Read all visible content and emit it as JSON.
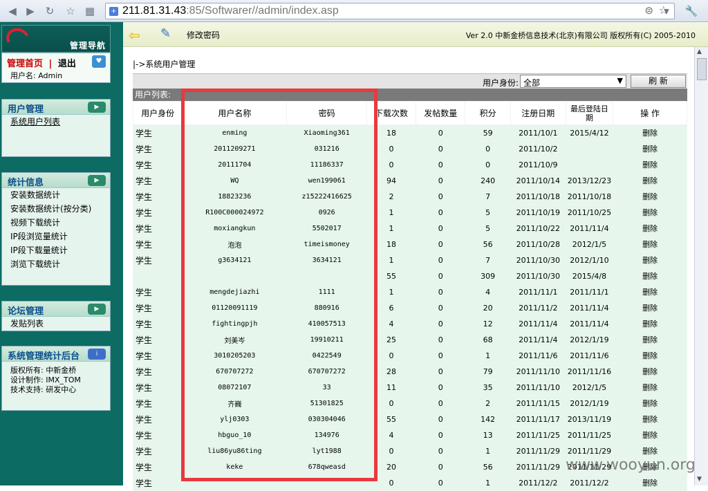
{
  "browser": {
    "url_host": "211.81.31.43",
    "url_rest": ":85/Softwarer//admin/index.asp"
  },
  "sidebar": {
    "nav_title": "管理导航",
    "home_link": "管理首页",
    "separator": "|",
    "logout_link": "退出",
    "username_line": "用户名: Admin",
    "user_mgmt": {
      "title": "用户管理",
      "items": [
        "系统用户列表"
      ]
    },
    "stats": {
      "title": "统计信息",
      "items": [
        "安装数据统计",
        "安装数据统计(按分类)",
        "视频下载统计",
        "IP段浏览量统计",
        "IP段下载量统计",
        "浏览下载统计"
      ]
    },
    "forum": {
      "title": "论坛管理",
      "items": [
        "发贴列表"
      ]
    },
    "backend": {
      "title": "系统管理统计后台",
      "lines": [
        "版权所有: 中新金桥",
        "设计制作: IMX_TOM",
        "技术支持: 研发中心"
      ]
    }
  },
  "topbar": {
    "change_password": "修改密码",
    "copyright": "Ver 2.0 中新金桥信息技术(北京)有限公司 版权所有(C) 2005-2010"
  },
  "main": {
    "breadcrumb": "|->系统用户管理",
    "filter_label": "用户身份:",
    "filter_value": "全部",
    "refresh_label": "刷 新",
    "list_label": "用户列表:",
    "columns": [
      "用户身份",
      "用户名称",
      "密码",
      "下载次数",
      "发帖数量",
      "积分",
      "注册日期",
      "最后登陆日期",
      "操 作"
    ],
    "rows": [
      [
        "学生",
        "enming",
        "Xiaoming361",
        "18",
        "0",
        "59",
        "2011/10/1",
        "2015/4/12",
        "删除"
      ],
      [
        "学生",
        "2011209271",
        "031216",
        "0",
        "0",
        "0",
        "2011/10/2",
        "",
        "删除"
      ],
      [
        "学生",
        "20111704",
        "11186337",
        "0",
        "0",
        "0",
        "2011/10/9",
        "",
        "删除"
      ],
      [
        "学生",
        "WQ",
        "wen199061",
        "94",
        "0",
        "240",
        "2011/10/14",
        "2013/12/23",
        "删除"
      ],
      [
        "学生",
        "18823236",
        "z15222416625",
        "2",
        "0",
        "7",
        "2011/10/18",
        "2011/10/18",
        "删除"
      ],
      [
        "学生",
        "R100C000024972",
        "0926",
        "1",
        "0",
        "5",
        "2011/10/19",
        "2011/10/25",
        "删除"
      ],
      [
        "学生",
        "moxiangkun",
        "5502017",
        "1",
        "0",
        "5",
        "2011/10/22",
        "2011/11/4",
        "删除"
      ],
      [
        "学生",
        "泡泡",
        "timeismoney",
        "18",
        "0",
        "56",
        "2011/10/28",
        "2012/1/5",
        "删除"
      ],
      [
        "学生",
        "g3634121",
        "3634121",
        "1",
        "0",
        "7",
        "2011/10/30",
        "2012/1/10",
        "删除"
      ],
      [
        "",
        "",
        "",
        "55",
        "0",
        "309",
        "2011/10/30",
        "2015/4/8",
        "删除"
      ],
      [
        "学生",
        "mengdejiazhi",
        "1111",
        "1",
        "0",
        "4",
        "2011/11/1",
        "2011/11/1",
        "删除"
      ],
      [
        "学生",
        "01120091119",
        "880916",
        "6",
        "0",
        "20",
        "2011/11/2",
        "2011/11/4",
        "删除"
      ],
      [
        "学生",
        "fightingpjh",
        "410057513",
        "4",
        "0",
        "12",
        "2011/11/4",
        "2011/11/4",
        "删除"
      ],
      [
        "学生",
        "刘美岑",
        "19910211",
        "25",
        "0",
        "68",
        "2011/11/4",
        "2012/1/19",
        "删除"
      ],
      [
        "学生",
        "3010205203",
        "0422549",
        "0",
        "0",
        "1",
        "2011/11/6",
        "2011/11/6",
        "删除"
      ],
      [
        "学生",
        "670707272",
        "670707272",
        "28",
        "0",
        "79",
        "2011/11/10",
        "2011/11/16",
        "删除"
      ],
      [
        "学生",
        "08072107",
        "33",
        "11",
        "0",
        "35",
        "2011/11/10",
        "2012/1/5",
        "删除"
      ],
      [
        "学生",
        "齐巍",
        "51301825",
        "0",
        "0",
        "2",
        "2011/11/15",
        "2012/1/19",
        "删除"
      ],
      [
        "学生",
        "ylj0303",
        "030304046",
        "55",
        "0",
        "142",
        "2011/11/17",
        "2013/11/19",
        "删除"
      ],
      [
        "学生",
        "hbguo_10",
        "134976",
        "4",
        "0",
        "13",
        "2011/11/25",
        "2011/11/25",
        "删除"
      ],
      [
        "学生",
        "liu86yu86ting",
        "lyt1988",
        "0",
        "0",
        "1",
        "2011/11/29",
        "2011/11/29",
        "删除"
      ],
      [
        "学生",
        "keke",
        "678qweasd",
        "20",
        "0",
        "56",
        "2011/11/29",
        "2011/11/29",
        "删除"
      ],
      [
        "学生",
        "",
        "",
        "0",
        "0",
        "1",
        "2011/12/2",
        "2011/12/2",
        "删除"
      ]
    ]
  },
  "watermark": "www.wooyun.org"
}
